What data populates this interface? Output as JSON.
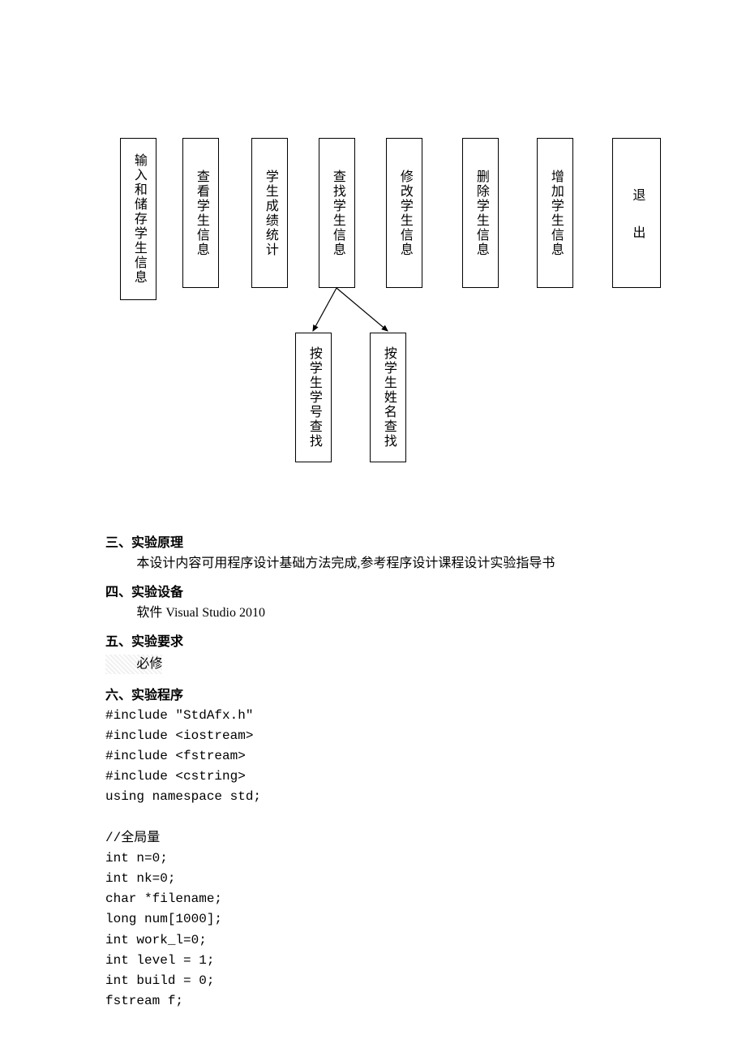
{
  "boxes": {
    "b1": "输入和储存学生信息",
    "b2": "查看学生信息",
    "b3": "学生成绩统计",
    "b4": "查找学生信息",
    "b5": "修改学生信息",
    "b6": "删除学生信息",
    "b7": "增加学生信息",
    "b8": "退出",
    "c1": "按学生学号查找",
    "c2": "按学生姓名查找"
  },
  "sections": {
    "s3_h": "三、实验原理",
    "s3_p": "本设计内容可用程序设计基础方法完成,参考程序设计课程设计实验指导书",
    "s4_h": "四、实验设备",
    "s4_p": "软件 Visual Studio 2010",
    "s5_h": "五、实验要求",
    "s5_p": "必修",
    "s6_h": "六、实验程序"
  },
  "code_lines": [
    "#include \"StdAfx.h\"",
    "#include <iostream>",
    "#include <fstream>",
    "#include <cstring>",
    "using namespace std;",
    "",
    "//全局量",
    "int n=0;",
    "int nk=0;",
    "char *filename;",
    "long num[1000];",
    "int work_l=0;",
    "int level = 1;",
    "int build = 0;",
    "fstream f;"
  ],
  "chart_data": {
    "type": "tree",
    "nodes": [
      {
        "id": "b1",
        "label": "输入和储存学生信息"
      },
      {
        "id": "b2",
        "label": "查看学生信息"
      },
      {
        "id": "b3",
        "label": "学生成绩统计"
      },
      {
        "id": "b4",
        "label": "查找学生信息"
      },
      {
        "id": "b5",
        "label": "修改学生信息"
      },
      {
        "id": "b6",
        "label": "删除学生信息"
      },
      {
        "id": "b7",
        "label": "增加学生信息"
      },
      {
        "id": "b8",
        "label": "退出"
      },
      {
        "id": "c1",
        "label": "按学生学号查找"
      },
      {
        "id": "c2",
        "label": "按学生姓名查找"
      }
    ],
    "edges": [
      {
        "from": "b4",
        "to": "c1"
      },
      {
        "from": "b4",
        "to": "c2"
      }
    ]
  }
}
